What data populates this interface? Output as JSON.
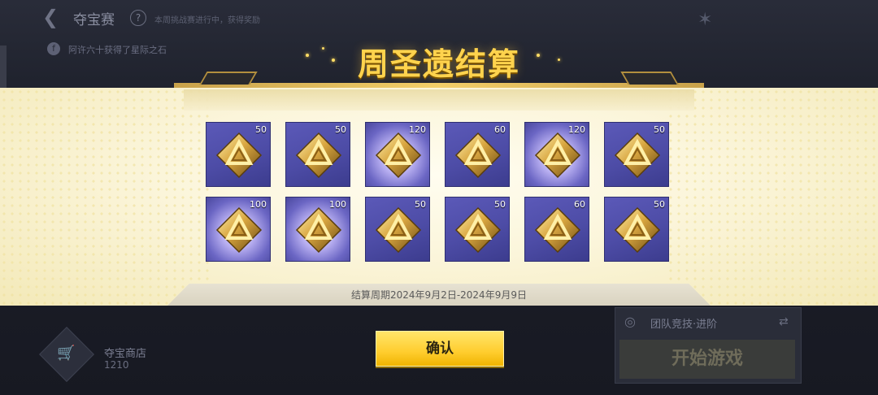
{
  "background": {
    "title": "夺宝赛",
    "help_label": "?",
    "subtext": "本周挑战赛进行中，获得奖励",
    "notice": "阿许六十获得了星际之石",
    "shop_name": "夺宝商店",
    "shop_coins": "1210",
    "mode_name": "团队竞技·进阶",
    "start_button": "开始游戏"
  },
  "modal": {
    "title": "周圣遗结算",
    "period": "结算周期2024年9月2日-2024年9月9日",
    "confirm_label": "确认"
  },
  "rewards": [
    {
      "qty": "50",
      "glow": false
    },
    {
      "qty": "50",
      "glow": false
    },
    {
      "qty": "120",
      "glow": true
    },
    {
      "qty": "60",
      "glow": false
    },
    {
      "qty": "120",
      "glow": true
    },
    {
      "qty": "50",
      "glow": false
    },
    {
      "qty": "100",
      "glow": true
    },
    {
      "qty": "100",
      "glow": true
    },
    {
      "qty": "50",
      "glow": false
    },
    {
      "qty": "50",
      "glow": false
    },
    {
      "qty": "60",
      "glow": false
    },
    {
      "qty": "50",
      "glow": false
    }
  ],
  "icons": {
    "reward": "golden-triangle-relic-icon",
    "back": "back-arrow-icon",
    "help": "help-icon",
    "shop": "cart-icon",
    "mode": "target-icon",
    "switch": "switch-icon"
  },
  "colors": {
    "title": "#ffd34d",
    "tile": "#4d4ca6",
    "confirm": "#ffcd2e"
  }
}
